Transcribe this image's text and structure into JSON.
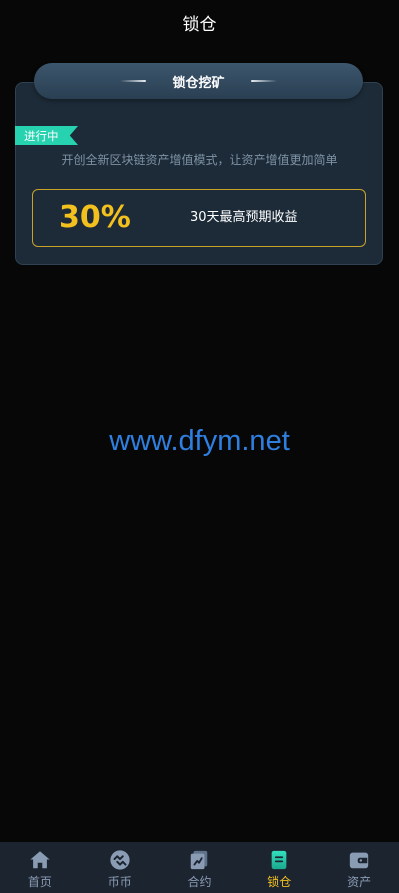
{
  "header": {
    "title": "锁仓"
  },
  "card": {
    "tab_title": "锁仓挖矿",
    "status": "进行中",
    "subtitle": "开创全新区块链资产增值模式，让资产增值更加简单",
    "yield_value": "30%",
    "yield_label": "30天最高预期收益"
  },
  "watermark": "www.dfym.net",
  "tabbar": {
    "items": [
      {
        "label": "首页",
        "icon": "home-icon"
      },
      {
        "label": "币币",
        "icon": "exchange-icon"
      },
      {
        "label": "合约",
        "icon": "contract-icon"
      },
      {
        "label": "锁仓",
        "icon": "lock-mining-icon"
      },
      {
        "label": "资产",
        "icon": "wallet-icon"
      }
    ],
    "active_index": 3
  },
  "colors": {
    "accent": "#f3c11e",
    "status": "#26d2b0",
    "tab_inactive": "#8a9cb4"
  }
}
